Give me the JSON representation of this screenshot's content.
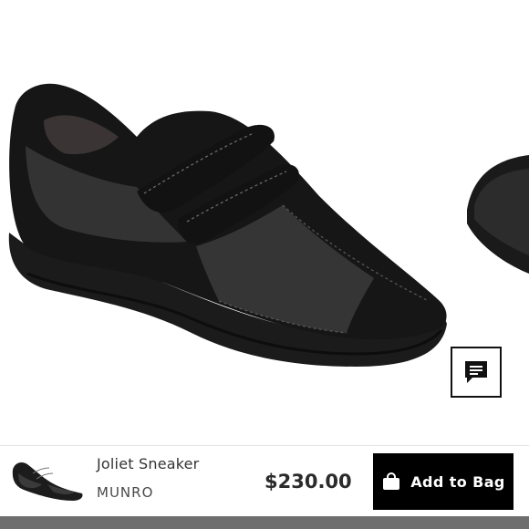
{
  "product": {
    "name": "Joliet Sneaker",
    "brand": "MUNRO",
    "price": "$230.00",
    "image_description": "black suede and mesh sneaker with double hook-and-loop straps",
    "thumbnail_description": "black sneaker thumbnail"
  },
  "actions": {
    "add_to_bag_label": "Add to Bag",
    "add_to_bag_icon": "shopping-bag-icon",
    "chat_icon": "chat-bubble-icon"
  },
  "colors": {
    "button_bg": "#000000",
    "button_text": "#ffffff",
    "price_text": "#2b2b2b",
    "bottom_strip": "#6e6e6e"
  }
}
